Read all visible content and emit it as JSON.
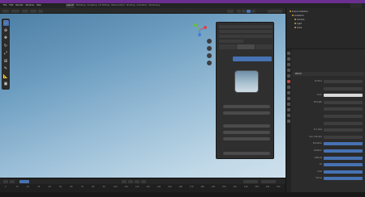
{
  "window": {
    "title_color": "#6a2f8f"
  },
  "menu": {
    "items": [
      "File",
      "Edit",
      "Render",
      "Window",
      "Help"
    ],
    "workspaces": [
      "Layout",
      "Modeling",
      "Sculpting",
      "UV Editing",
      "Texture Paint",
      "Shading",
      "Animation",
      "Rendering"
    ]
  },
  "tools": [
    {
      "icon": "cursor-select-icon",
      "glyph": "⬚",
      "active": true
    },
    {
      "icon": "cursor-icon",
      "glyph": "⊕"
    },
    {
      "icon": "move-icon",
      "glyph": "✥"
    },
    {
      "icon": "rotate-icon",
      "glyph": "↻"
    },
    {
      "icon": "scale-icon",
      "glyph": "⤢"
    },
    {
      "icon": "transform-icon",
      "glyph": "⊞"
    },
    {
      "icon": "annotate-icon",
      "glyph": "✎"
    },
    {
      "icon": "measure-icon",
      "glyph": "📐"
    },
    {
      "icon": "add-cube-icon",
      "glyph": "▣"
    }
  ],
  "viewport": {
    "nav_icons": [
      "zoom-icon",
      "pan-icon",
      "camera-icon",
      "perspective-icon"
    ],
    "npanel": {
      "tabs": [
        "",
        "",
        ""
      ],
      "primary_button": "",
      "captions": [
        "",
        "",
        "",
        ""
      ]
    }
  },
  "timeline": {
    "frames": [
      "0",
      "10",
      "20",
      "30",
      "40",
      "50",
      "60",
      "70",
      "80",
      "90",
      "100",
      "110",
      "120",
      "130",
      "140",
      "150",
      "160",
      "170",
      "180",
      "190",
      "200",
      "210",
      "220",
      "230",
      "240",
      "250"
    ]
  },
  "outliner": {
    "rows": [
      "Scene Collection",
      "Collection",
      "Camera",
      "Light",
      "Cube"
    ]
  },
  "properties": {
    "header": "World",
    "rows": [
      {
        "label": "Surface",
        "style": "dark"
      },
      {
        "label": "",
        "style": "dark"
      },
      {
        "label": "Color",
        "style": "white"
      },
      {
        "label": "Strength",
        "style": "dark"
      },
      {
        "label": "",
        "style": "dark"
      },
      {
        "label": "",
        "style": "dark"
      },
      {
        "label": "",
        "style": "dark"
      },
      {
        "label": "Sun Size",
        "style": "dark"
      },
      {
        "label": "Sun Intensity",
        "style": "dark"
      },
      {
        "label": "Elevation",
        "style": "blue"
      },
      {
        "label": "Rotation",
        "style": "blue"
      },
      {
        "label": "Altitude",
        "style": "blue"
      },
      {
        "label": "Air",
        "style": "blue"
      },
      {
        "label": "Dust",
        "style": "blue"
      },
      {
        "label": "Ozone",
        "style": "blue"
      }
    ]
  }
}
